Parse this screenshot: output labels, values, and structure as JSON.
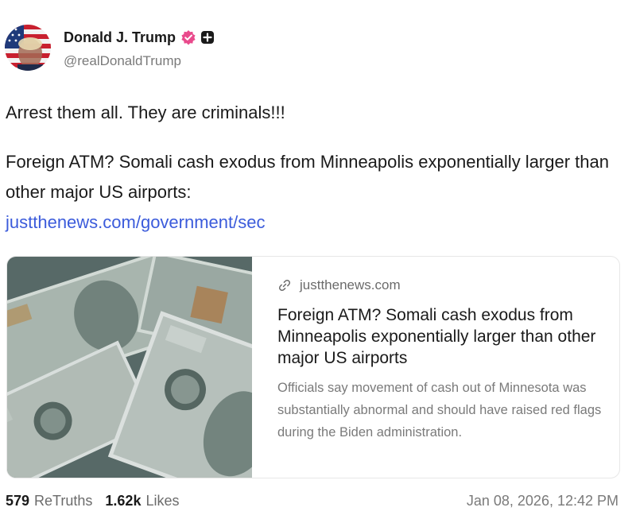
{
  "author": {
    "display_name": "Donald J. Trump",
    "handle": "@realDonaldTrump",
    "verified_icon": "verified-badge-icon",
    "extra_badge_icon": "plus-badge-icon",
    "verified_color": "#e94a8c"
  },
  "post": {
    "line1": "Arrest them all. They are criminals!!!",
    "line2": "Foreign ATM? Somali cash exodus from Minneapolis exponentially larger than other major US airports:",
    "link_text": "justthenews.com/government/sec",
    "link_color": "#3b5bdb"
  },
  "link_card": {
    "domain": "justthenews.com",
    "domain_icon": "link-icon",
    "title": "Foreign ATM? Somali cash exodus from Minneapolis exponentially larger than other major US airports",
    "description": "Officials say movement of cash out of Minnesota was substantially abnormal and should have raised red flags during the Biden administration.",
    "image": "stack-of-100-dollar-bills"
  },
  "stats": {
    "retruths_count": "579",
    "retruths_label": "ReTruths",
    "likes_count": "1.62k",
    "likes_label": "Likes",
    "timestamp": "Jan 08, 2026, 12:42 PM"
  }
}
